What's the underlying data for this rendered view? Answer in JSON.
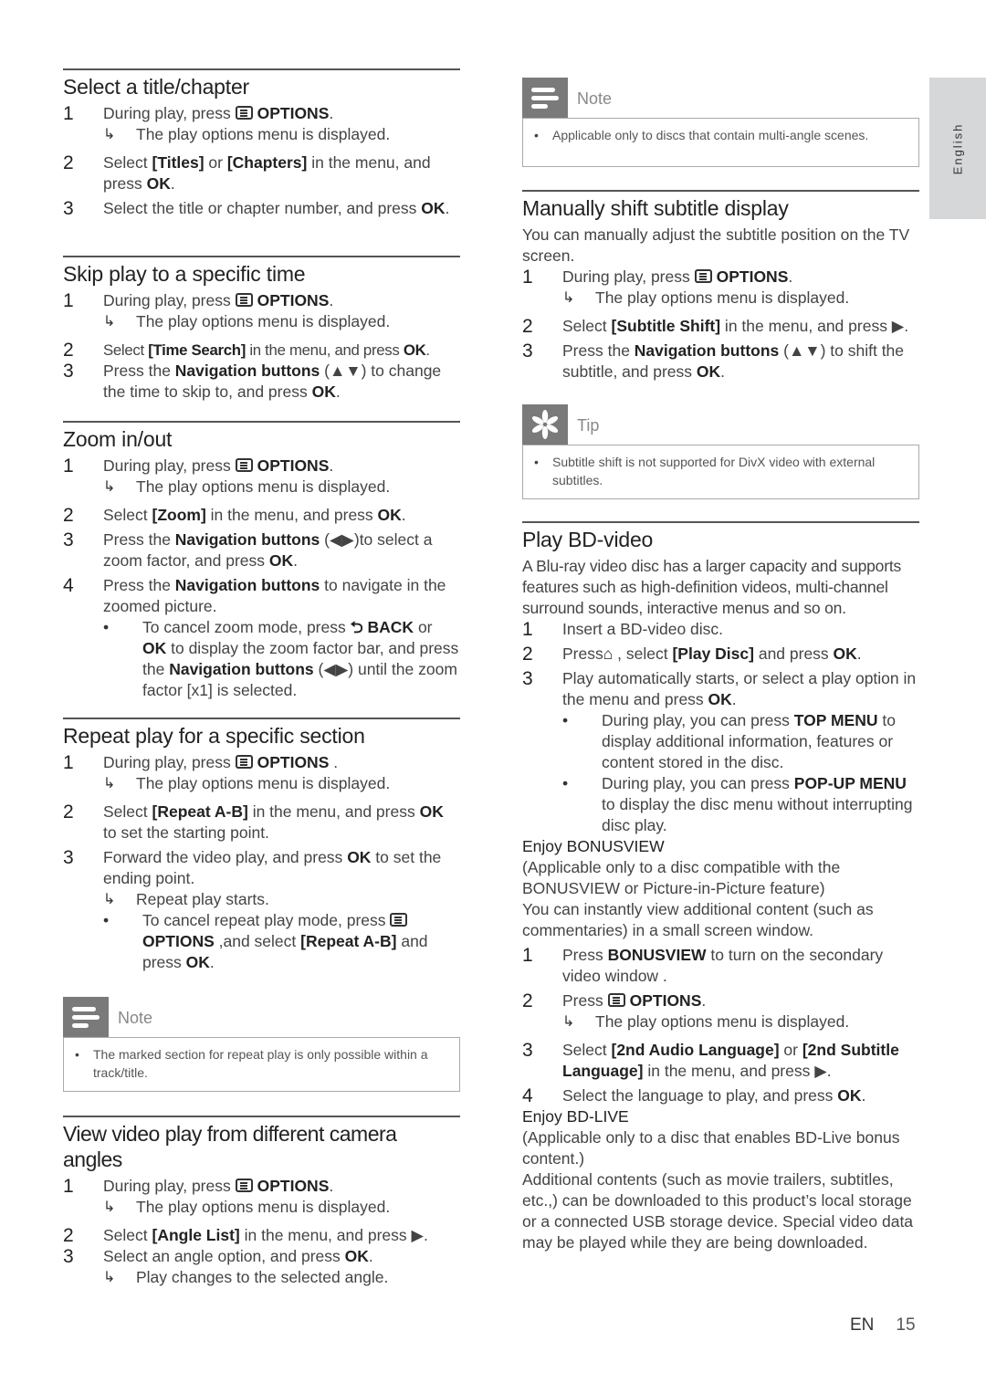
{
  "side_tab": "English",
  "footer": {
    "lang": "EN",
    "page": "15"
  },
  "common": {
    "options_icon": "options-icon",
    "arrow": "↳",
    "bullet": "•"
  },
  "left": {
    "s1": {
      "title": "Select a title/chapter",
      "step1": {
        "num": "1",
        "pre": "During play, press ",
        "key": "OPTIONS",
        "post": "."
      },
      "result1": "The play options menu is displayed.",
      "step2": {
        "num": "2",
        "t1": "Select ",
        "k1": "[Titles]",
        "t2": " or ",
        "k2": "[Chapters]",
        "t3": " in the menu, and press ",
        "k3": "OK",
        "t4": "."
      },
      "step3": {
        "num": "3",
        "t1": "Select the title or chapter number, and press ",
        "k1": "OK",
        "t2": "."
      }
    },
    "s2": {
      "title": "Skip play to a specific time",
      "step1": {
        "num": "1",
        "pre": "During play, press ",
        "key": "OPTIONS",
        "post": "."
      },
      "result1": "The play options menu is displayed.",
      "step2": {
        "num": "2",
        "t1": "Select ",
        "k1": "[Time Search]",
        "t2": " in the menu, and press ",
        "k2": "OK",
        "t3": "."
      },
      "step3": {
        "num": "3",
        "t1": "Press the ",
        "k1": "Navigation buttons",
        "t2": " (▲▼) to change the time to skip to, and press ",
        "k2": "OK",
        "t3": "."
      }
    },
    "s3": {
      "title": "Zoom in/out",
      "step1": {
        "num": "1",
        "pre": "During play, press ",
        "key": "OPTIONS",
        "post": "."
      },
      "result1": "The play options menu is displayed.",
      "step2": {
        "num": "2",
        "t1": "Select ",
        "k1": "[Zoom]",
        "t2": " in the menu, and press ",
        "k2": "OK",
        "t3": "."
      },
      "step3": {
        "num": "3",
        "t1": "Press the ",
        "k1": "Navigation buttons",
        "t2": " (◀▶)to select a zoom factor, and press ",
        "k2": "OK",
        "t3": "."
      },
      "step4": {
        "num": "4",
        "t1": "Press the ",
        "k1": "Navigation buttons",
        "t2": " to navigate in the zoomed picture."
      },
      "bullet1": {
        "t1": "To cancel zoom mode, press ",
        "icon": "⮌",
        "k1": "BACK",
        "t2": " or ",
        "k2": "OK",
        "t3": " to display the zoom factor bar, and press the ",
        "k3": "Navigation buttons",
        "t4": " (◀▶) until the zoom factor [x1] is selected."
      }
    },
    "s4": {
      "title": "Repeat play for a specific section",
      "step1": {
        "num": "1",
        "pre": "During play, press ",
        "key": "OPTIONS",
        "post": " ."
      },
      "result1": "The play options menu is displayed.",
      "step2": {
        "num": "2",
        "t1": "Select ",
        "k1": "[Repeat A-B]",
        "t2": " in the menu, and press ",
        "k2": "OK",
        "t3": " to set the starting point."
      },
      "step3": {
        "num": "3",
        "t1": "Forward the video play, and press ",
        "k1": "OK",
        "t2": " to set the ending point."
      },
      "result3": "Repeat play starts.",
      "bullet1": {
        "t1": "To cancel repeat play mode, press ",
        "k1": "OPTIONS",
        "t2": " ,and select ",
        "k2": "[Repeat A-B]",
        "t3": " and press ",
        "k3": "OK",
        "t4": "."
      }
    },
    "note1": {
      "label": "Note",
      "text": "The marked section for repeat play is only possible within a track/title."
    },
    "s5": {
      "title": "View video play from different camera angles",
      "step1": {
        "num": "1",
        "pre": "During play, press ",
        "key": "OPTIONS",
        "post": "."
      },
      "result1": "The play options menu is displayed.",
      "step2": {
        "num": "2",
        "t1": "Select ",
        "k1": "[Angle List]",
        "t2": " in the menu, and press ▶."
      },
      "step3": {
        "num": "3",
        "t1": "Select an angle option, and press ",
        "k1": "OK",
        "t2": "."
      },
      "result3": "Play changes to the selected angle."
    }
  },
  "right": {
    "note2": {
      "label": "Note",
      "text": "Applicable only to discs that contain multi-angle scenes."
    },
    "s6": {
      "title": "Manually shift subtitle display",
      "intro": "You can manually adjust the subtitle position on the TV screen.",
      "step1": {
        "num": "1",
        "pre": "During play, press ",
        "key": "OPTIONS",
        "post": "."
      },
      "result1": "The play options menu is displayed.",
      "step2": {
        "num": "2",
        "t1": "Select ",
        "k1": "[Subtitle Shift]",
        "t2": " in the menu, and press ▶."
      },
      "step3": {
        "num": "3",
        "t1": "Press the ",
        "k1": "Navigation buttons",
        "t2": " (▲▼) to shift the subtitle, and press ",
        "k2": "OK",
        "t3": "."
      }
    },
    "tip1": {
      "label": "Tip",
      "text": "Subtitle shift is not supported for DivX video with external subtitles."
    },
    "s7": {
      "title": "Play BD-video",
      "intro": "A Blu-ray video disc has a larger capacity and supports features such as high-definition videos, multi-channel surround sounds, interactive menus and so on.",
      "step1": {
        "num": "1",
        "t1": "Insert a BD-video disc."
      },
      "step2": {
        "num": "2",
        "t1": "Press",
        "icon": "⌂",
        "t2": " , select ",
        "k1": "[Play Disc]",
        "t3": " and press ",
        "k2": "OK",
        "t4": "."
      },
      "step3": {
        "num": "3",
        "t1": "Play automatically starts, or select a play option in the menu and press ",
        "k1": "OK",
        "t2": "."
      },
      "bullet1": {
        "t1": "During play, you can press ",
        "k1": "TOP MENU",
        "t2": " to display additional information, features or content stored in the disc."
      },
      "bullet2": {
        "t1": "During play, you can press ",
        "k1": "POP-UP MENU",
        "t2": " to display the disc menu without interrupting disc play."
      },
      "bonus": {
        "heading_pre": "Enjoy ",
        "heading_key": "BONUSVIEW",
        "p1": "(Applicable only to a disc compatible with the BONUSVIEW or Picture-in-Picture feature)",
        "p2": "You can instantly view additional content (such as commentaries) in a small screen window.",
        "step1": {
          "num": "1",
          "t1": "Press ",
          "k1": "BONUSVIEW",
          "t2": " to turn on the secondary video window ."
        },
        "step2": {
          "num": "2",
          "pre": "Press ",
          "key": "OPTIONS",
          "post": "."
        },
        "result2": "The play options menu is displayed.",
        "step3": {
          "num": "3",
          "t1": "Select ",
          "k1": "[2nd Audio Language]",
          "t2": " or ",
          "k2": "[2nd Subtitle Language]",
          "t3": " in the menu, and press ▶."
        },
        "step4": {
          "num": "4",
          "t1": "Select the language to play, and press ",
          "k1": "OK",
          "t2": "."
        }
      },
      "bdlive": {
        "heading_pre": "Enjoy ",
        "heading_key": "BD-LIVE",
        "p1": "(Applicable only to a disc that enables BD-Live bonus content.)",
        "p2": "Additional contents (such as movie trailers, subtitles, etc.,) can be downloaded to this product’s local storage or a connected USB storage device. Special video data may be played while they are being downloaded."
      }
    }
  }
}
